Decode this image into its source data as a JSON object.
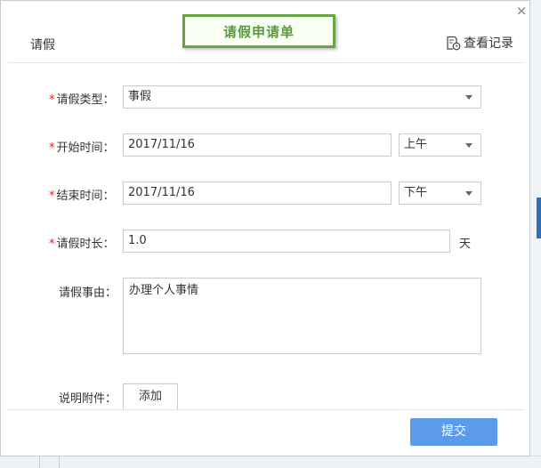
{
  "window": {
    "close_glyph": "×"
  },
  "callout": {
    "text": "请假申请单",
    "border_color": "#66a444"
  },
  "header": {
    "title": "请假",
    "view_records": "查看记录",
    "view_records_icon": "document-clock-icon"
  },
  "form": {
    "required_mark": "*",
    "leave_type": {
      "label": "请假类型：",
      "value": "事假"
    },
    "start_time": {
      "label": "开始时间：",
      "date": "2017/11/16",
      "period": "上午"
    },
    "end_time": {
      "label": "结束时间：",
      "date": "2017/11/16",
      "period": "下午"
    },
    "duration": {
      "label": "请假时长：",
      "value": "1.0",
      "unit": "天"
    },
    "reason": {
      "label": "请假事由：",
      "value": "办理个人事情"
    },
    "attachment": {
      "label": "说明附件：",
      "button": "添加"
    }
  },
  "footer": {
    "submit": "提交"
  },
  "colors": {
    "accent": "#5b9bea",
    "required": "#d9251f"
  }
}
